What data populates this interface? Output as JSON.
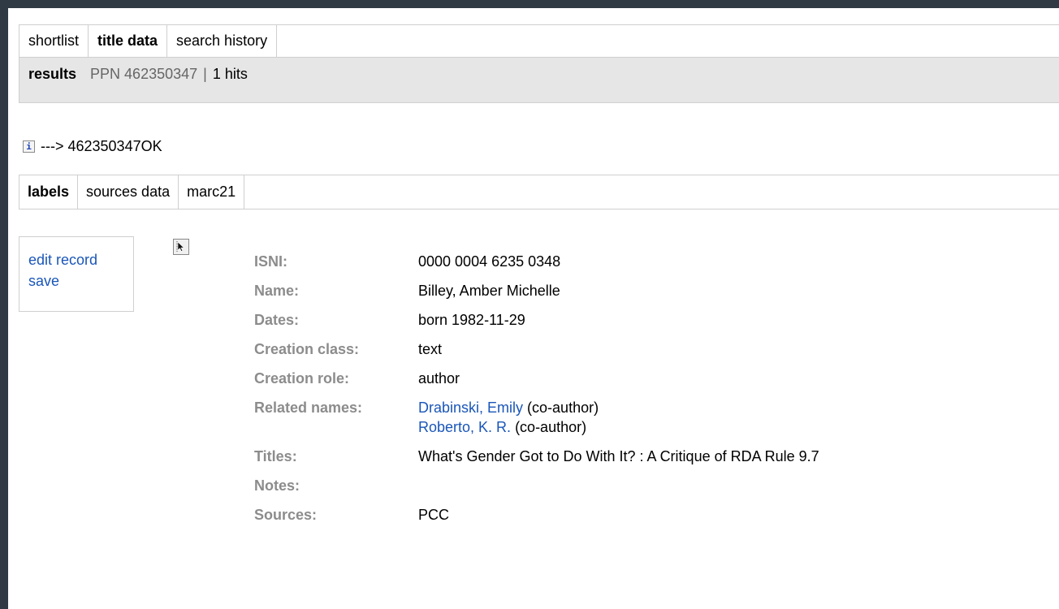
{
  "tabs": {
    "shortlist": "shortlist",
    "title_data": "title data",
    "search_history": "search history"
  },
  "results": {
    "label": "results",
    "ppn": "PPN 462350347",
    "separator": "|",
    "hits": "1 hits"
  },
  "info": {
    "icon_glyph": "i",
    "message": "---> 462350347OK"
  },
  "subtabs": {
    "labels": "labels",
    "sources_data": "sources data",
    "marc21": "marc21"
  },
  "actions": {
    "edit_record": "edit record",
    "save": "save"
  },
  "record": {
    "isni": {
      "label": "ISNI:",
      "value": "0000 0004 6235 0348"
    },
    "name": {
      "label": "Name:",
      "value": "Billey, Amber Michelle"
    },
    "dates": {
      "label": "Dates:",
      "value": "born 1982-11-29"
    },
    "creation_class": {
      "label": "Creation class:",
      "value": "text"
    },
    "creation_role": {
      "label": "Creation role:",
      "value": "author"
    },
    "related_names": {
      "label": "Related names:",
      "items": [
        {
          "name": "Drabinski, Emily",
          "role": "(co-author)"
        },
        {
          "name": "Roberto, K. R.",
          "role": "(co-author)"
        }
      ]
    },
    "titles": {
      "label": "Titles:",
      "value": "What's Gender Got to Do With It? : A Critique of RDA Rule 9.7"
    },
    "notes": {
      "label": "Notes:",
      "value": ""
    },
    "sources": {
      "label": "Sources:",
      "value": "PCC"
    }
  },
  "colors": {
    "outer_frame": "#2f3a45",
    "link": "#1a56b8",
    "label_gray": "#8c8c8c",
    "results_bar_bg": "#e6e6e6"
  }
}
